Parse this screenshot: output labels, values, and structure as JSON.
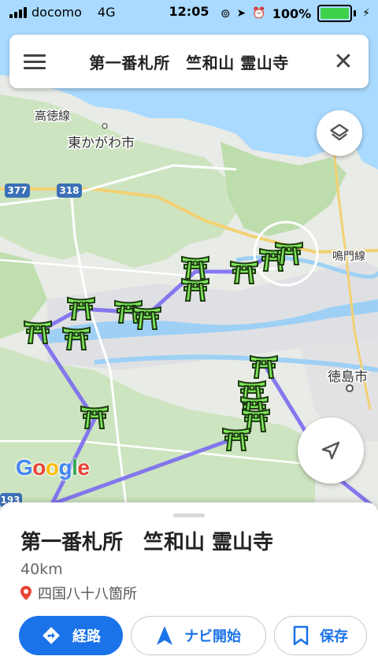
{
  "status_bar": {
    "carrier": "docomo",
    "network": "4G",
    "time": "12:05",
    "battery": "100%"
  },
  "search": {
    "title": "第一番札所　竺和山 霊山寺"
  },
  "map": {
    "labels": {
      "kotoku_line": "高徳線",
      "higashikagawa": "東かがわ市",
      "naruto_line": "鳴門線",
      "tokushima_city": "徳島市",
      "route_377": "377",
      "route_318": "318",
      "route_193": "193",
      "google": "Google"
    }
  },
  "place": {
    "title": "第一番札所　竺和山 霊山寺",
    "distance": "40km",
    "category": "四国八十八箇所"
  },
  "actions": {
    "directions": "経路",
    "navigate": "ナビ開始",
    "save": "保存"
  },
  "colors": {
    "accent": "#1a73e8",
    "route": "#7b6cf0",
    "marker": "#7ee85a",
    "water": "#aadaff"
  }
}
